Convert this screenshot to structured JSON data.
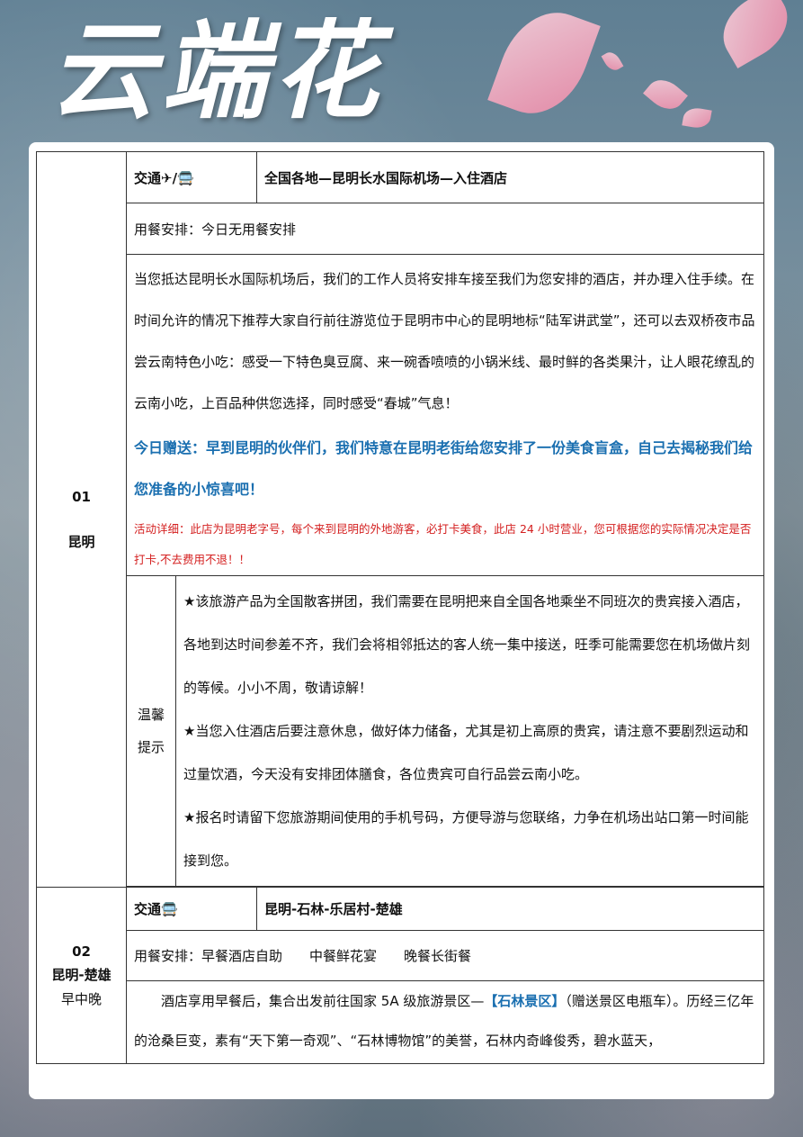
{
  "header": {
    "title_art": "云端花"
  },
  "day1": {
    "num": "01",
    "city": "昆明",
    "transport_label": "交通✈/🚍",
    "route": "全国各地—昆明长水国际机场—入住酒店",
    "meals": "用餐安排：今日无用餐安排",
    "desc": "当您抵达昆明长水国际机场后，我们的工作人员将安排车接至我们为您安排的酒店，并办理入住手续。在时间允许的情况下推荐大家自行前往游览位于昆明市中心的昆明地标“陆军讲武堂”，还可以去双桥夜市品尝云南特色小吃：感受一下特色臭豆腐、来一碗香喷喷的小锅米线、最时鲜的各类果汁，让人眼花缭乱的云南小吃，上百品种供您选择，同时感受“春城”气息！",
    "gift": "今日赠送：早到昆明的伙伴们，我们特意在昆明老街给您安排了一份美食盲盒，自己去揭秘我们给您准备的小惊喜吧！",
    "gift_detail": "活动详细：此店为昆明老字号，每个来到昆明的外地游客，必打卡美食，此店 24 小时营业，您可根据您的实际情况决定是否打卡,不去费用不退！！",
    "tips_label_1": "温馨",
    "tips_label_2": "提示",
    "tips": [
      "★该旅游产品为全国散客拼团，我们需要在昆明把来自全国各地乘坐不同班次的贵宾接入酒店，各地到达时间参差不齐，我们会将相邻抵达的客人统一集中接送，旺季可能需要您在机场做片刻的等候。小小不周，敬请谅解！",
      "★当您入住酒店后要注意休息，做好体力储备，尤其是初上高原的贵宾，请注意不要剧烈运动和过量饮酒，今天没有安排团体膳食，各位贵宾可自行品尝云南小吃。",
      "★报名时请留下您旅游期间使用的手机号码，方便导游与您联络，力争在机场出站口第一时间能接到您。"
    ]
  },
  "day2": {
    "num": "02",
    "city": "昆明-楚雄",
    "meals_short": "早中晚",
    "transport_label": "交通🚍",
    "route": "昆明-石林-乐居村-楚雄",
    "meals": "用餐安排：早餐酒店自助　　中餐鲜花宴　　晚餐长街餐",
    "desc_pre": "　　酒店享用早餐后，集合出发前往国家 5A 级旅游景区—",
    "desc_highlight": "【石林景区】",
    "desc_post": "（赠送景区电瓶车）。历经三亿年的沧桑巨变，素有“天下第一奇观”、“石林博物馆”的美誉，石林内奇峰俊秀，碧水蓝天，"
  }
}
